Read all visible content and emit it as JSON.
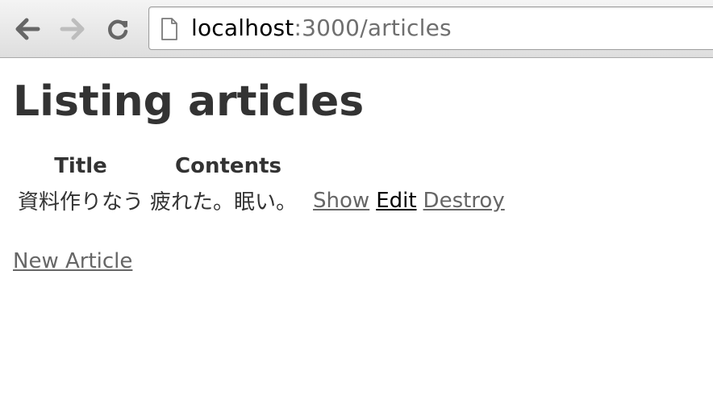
{
  "browser": {
    "url_host": "localhost",
    "url_path": ":3000/articles",
    "icons": {
      "back": "arrow-left-icon",
      "forward": "arrow-right-icon",
      "reload": "reload-icon",
      "page": "page-icon"
    }
  },
  "page": {
    "title": "Listing articles",
    "table": {
      "headers": [
        "Title",
        "Contents"
      ],
      "rows": [
        {
          "title": "資料作りなう",
          "contents": "疲れた。眠い。",
          "show_label": "Show",
          "edit_label": "Edit",
          "destroy_label": "Destroy"
        }
      ]
    },
    "new_article_label": "New Article"
  },
  "colors": {
    "text": "#333333",
    "link": "#666666",
    "link_visited": "#000000"
  }
}
